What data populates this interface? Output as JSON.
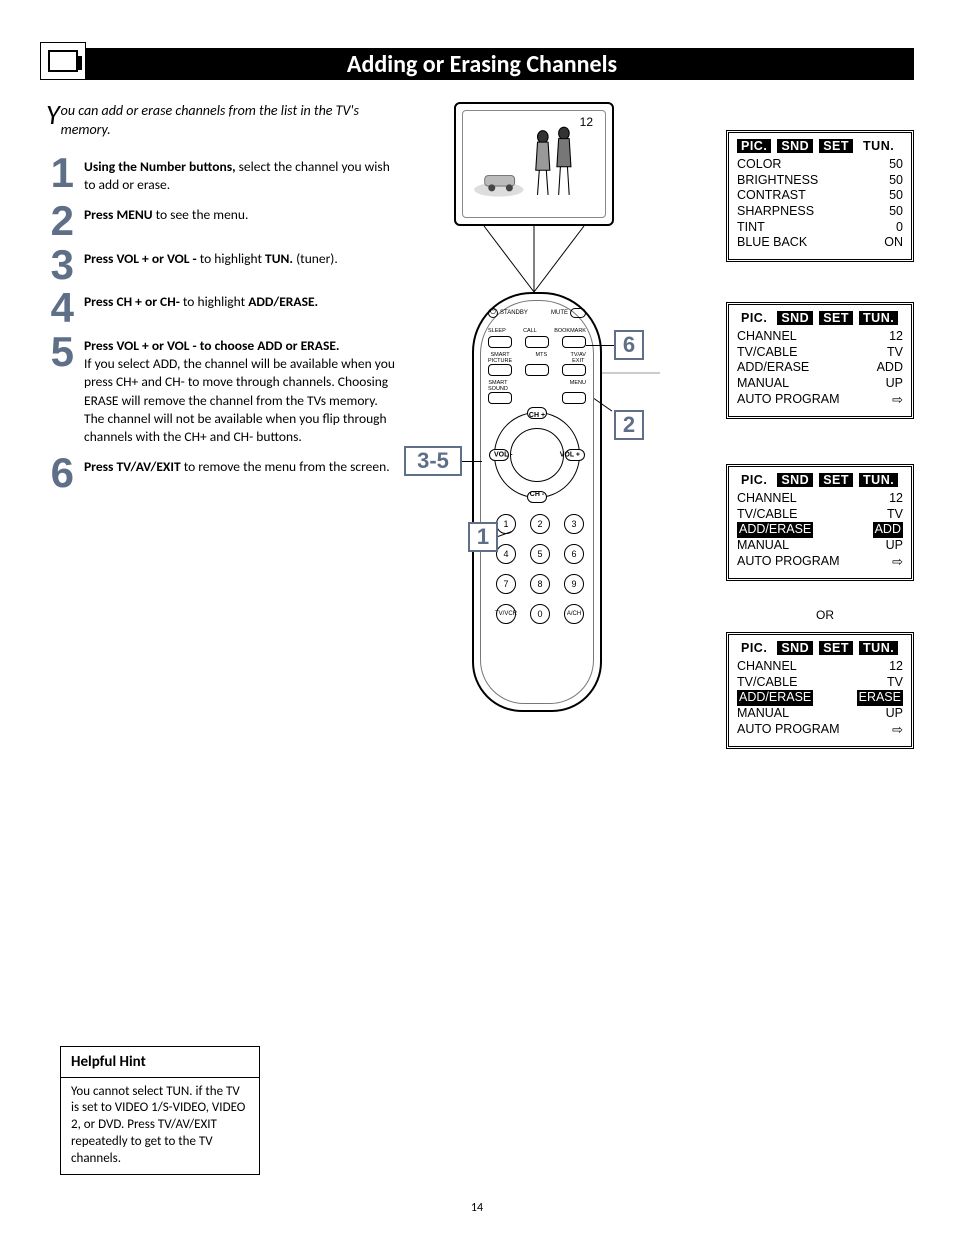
{
  "title": "Adding or Erasing Channels",
  "intro_first": "Y",
  "intro_rest": "ou can add or erase channels from the list in the TV's memory.",
  "steps": [
    {
      "n": "1",
      "bold": "Using the Number buttons,",
      "rest": " select the channel you wish to add or erase."
    },
    {
      "n": "2",
      "bold": "Press MENU",
      "rest": " to see the menu."
    },
    {
      "n": "3",
      "bold": "Press VOL + or VOL -",
      "rest": " to highlight ",
      "bold2": "TUN.",
      "rest2": " (tuner)."
    },
    {
      "n": "4",
      "bold": "Press CH + or CH-",
      "rest": " to highlight ",
      "bold2": "ADD/ERASE."
    },
    {
      "n": "5",
      "bold": "Press VOL + or VOL - to choose ADD or ERASE.",
      "rest": " If you select ADD, the channel will be available when you press CH+ and CH- to move through channels. Choosing ERASE will remove the channel from the TVs memory.  The channel will not be available when you flip through channels with the CH+ and CH- buttons."
    },
    {
      "n": "6",
      "bold": "Press TV/AV/EXIT",
      "rest": " to remove the menu from the screen."
    }
  ],
  "tv_channel": "12",
  "remote": {
    "standby": "STANDBY",
    "mute": "MUTE",
    "row1": [
      "SLEEP",
      "CALL",
      "BOOKMARK"
    ],
    "row2": [
      "SMART\nPICTURE",
      "MTS",
      "TV/AV\nEXIT"
    ],
    "row3": [
      "SMART\nSOUND",
      "",
      "MENU"
    ],
    "ring": {
      "chp": "CH +",
      "chm": "CH -",
      "volm": "VOL -",
      "volp": "VOL +"
    },
    "num_bl": "TV/VCR",
    "num_br": "A/CH"
  },
  "callouts": {
    "c1": "1",
    "c2": "2",
    "c35": "3-5",
    "c6": "6"
  },
  "osd_tabs": [
    "PIC.",
    "SND",
    "SET",
    "TUN."
  ],
  "osd1_rows": [
    [
      "COLOR",
      "50"
    ],
    [
      "BRIGHTNESS",
      "50"
    ],
    [
      "CONTRAST",
      "50"
    ],
    [
      "SHARPNESS",
      "50"
    ],
    [
      "TINT",
      "0"
    ],
    [
      "BLUE BACK",
      "ON"
    ]
  ],
  "osd_tun_rows_a": [
    [
      "CHANNEL",
      "12"
    ],
    [
      "TV/CABLE",
      "TV"
    ],
    [
      "ADD/ERASE",
      "ADD"
    ],
    [
      "MANUAL",
      "UP"
    ],
    [
      "AUTO PROGRAM",
      "⇨"
    ]
  ],
  "osd_tun_rows_b": [
    [
      "CHANNEL",
      "12"
    ],
    [
      "TV/CABLE",
      "TV"
    ],
    [
      "ADD/ERASE",
      "ADD"
    ],
    [
      "MANUAL",
      "UP"
    ],
    [
      "AUTO PROGRAM",
      "⇨"
    ]
  ],
  "osd_tun_rows_c": [
    [
      "CHANNEL",
      "12"
    ],
    [
      "TV/CABLE",
      "TV"
    ],
    [
      "ADD/ERASE",
      "ERASE"
    ],
    [
      "MANUAL",
      "UP"
    ],
    [
      "AUTO PROGRAM",
      "⇨"
    ]
  ],
  "or_label": "OR",
  "hint_title": "Helpful Hint",
  "hint_body": "You cannot select TUN. if the TV is set to VIDEO 1/S-VIDEO, VIDEO 2, or DVD. Press TV/AV/EXIT repeatedly to get to the TV channels.",
  "page_num": "14"
}
